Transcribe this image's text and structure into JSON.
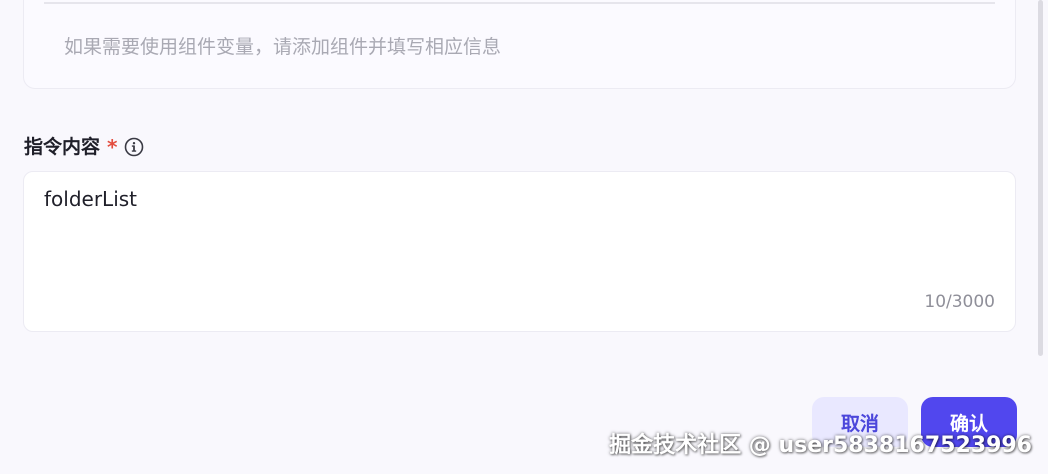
{
  "variables_panel": {
    "hint": "如果需要使用组件变量，请添加组件并填写相应信息"
  },
  "instruction_field": {
    "label": "指令内容",
    "required_mark": "*",
    "info_icon": "info-circle-icon",
    "value": "folderList",
    "char_count": "10/3000"
  },
  "footer": {
    "cancel_label": "取消",
    "confirm_label": "确认"
  },
  "watermark": {
    "text": "掘金技术社区 @ user5838167523996"
  },
  "colors": {
    "primary": "#5147ee",
    "cancel_bg": "#e9e8ff",
    "required": "#e34d3f",
    "background": "#f9f8fd"
  }
}
